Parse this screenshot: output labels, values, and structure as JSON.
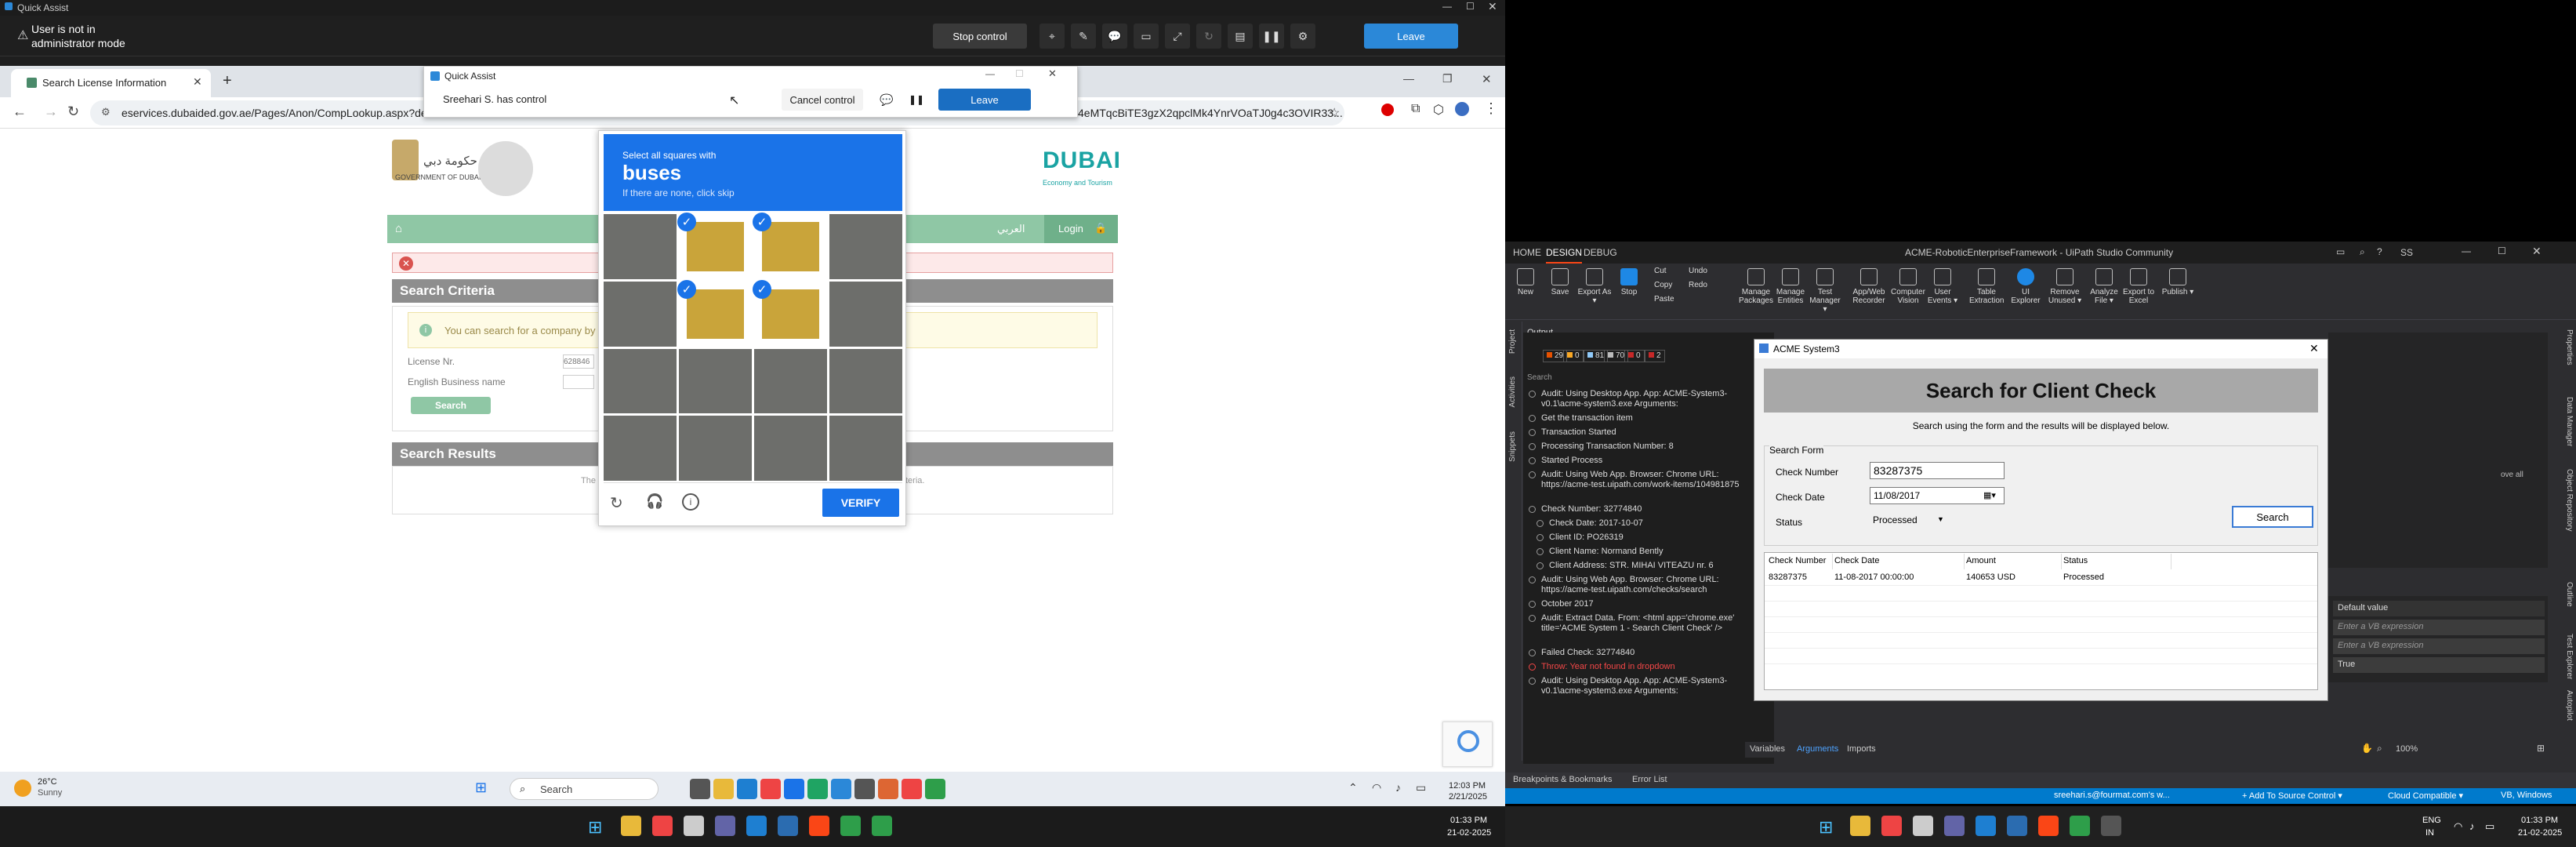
{
  "left": {
    "qa_window_title": "Quick Assist",
    "user_notice_line1": "User is not in",
    "user_notice_line2": "administrator mode",
    "stop_control": "Stop control",
    "leave": "Leave",
    "browser": {
      "tab_title": "Search License Information",
      "url": "eservices.dubaided.gov.ae/Pages/Anon/CompLookup.aspx?de",
      "url_tail": "4eMTqcBiTE3gzX2qpclMk4YnrVOaTJ0g4c3OVIR33...",
      "new_tab": "+"
    },
    "quick_assist_float": {
      "title": "Quick Assist",
      "status": "Sreehari S. has control",
      "cancel_control": "Cancel control",
      "leave": "Leave"
    },
    "dubai": {
      "gov_line1": "حكومة دبي",
      "gov_line2": "GOVERNMENT OF DUBAI",
      "ded_logo": "DUBAI",
      "ded_sub": "Economy and Tourism",
      "nav_arabic": "العربي",
      "nav_login": "Login",
      "search_criteria": "Search Criteria",
      "notice": "You can search for a company by lic",
      "license_label": "License Nr.",
      "license_placeholder": "628846",
      "business_label": "English Business name",
      "search_btn": "Search",
      "search_results": "Search Results",
      "results_text_left": "The",
      "results_text_right": "teria."
    },
    "captcha": {
      "instruction": "Select all squares with",
      "object": "buses",
      "hint": "If there are none, click skip",
      "verify": "VERIFY",
      "selected_cells": [
        1,
        2,
        5,
        6
      ]
    },
    "taskbar": {
      "temp": "26°C",
      "weather": "Sunny",
      "search": "Search",
      "time": "12:03 PM",
      "date": "2/21/2025"
    },
    "outer_time": "01:33 PM",
    "outer_date": "21-02-2025"
  },
  "studio": {
    "title": "ACME-RoboticEnterpriseFramework - UiPath Studio Community",
    "tabs": [
      "HOME",
      "DESIGN",
      "DEBUG"
    ],
    "user_initials": "SS",
    "ribbon": [
      {
        "label": "New"
      },
      {
        "label": "Save"
      },
      {
        "label": "Export As ▾"
      },
      {
        "label": "Stop"
      },
      {
        "label": "Cut"
      },
      {
        "label": "Copy"
      },
      {
        "label": "Paste"
      },
      {
        "label": "Undo"
      },
      {
        "label": "Redo"
      },
      {
        "label": "Manage Packages"
      },
      {
        "label": "Manage Entities"
      },
      {
        "label": "Test Manager ▾"
      },
      {
        "label": "App/Web Recorder"
      },
      {
        "label": "Computer Vision"
      },
      {
        "label": "User Events ▾"
      },
      {
        "label": "Table Extraction"
      },
      {
        "label": "UI Explorer"
      },
      {
        "label": "Remove Unused ▾"
      },
      {
        "label": "Analyze File ▾"
      },
      {
        "label": "Export to Excel"
      },
      {
        "label": "Publish ▾"
      }
    ],
    "output_title": "Output",
    "output_counts": [
      "29",
      "0",
      "81",
      "70",
      "0",
      "2"
    ],
    "output_search": "Search",
    "output_lines": [
      "Audit: Using Desktop App. App: ACME-System3-v0.1\\acme-system3.exe Arguments:",
      "Get the transaction item",
      "Transaction Started",
      "Processing Transaction Number: 8",
      "Started Process",
      "Audit: Using Web App. Browser: Chrome URL: https://acme-test.uipath.com/work-items/104981875",
      "Check Number: 32774840",
      "Check Date: 2017-10-07",
      "Client ID: PO26319",
      "Client Name: Normand Bently",
      "Client Address: STR. MIHAI VITEAZU nr. 6",
      "Audit: Using Web App. Browser: Chrome URL: https://acme-test.uipath.com/checks/search",
      "October 2017",
      "Audit: Extract Data. From: <html app='chrome.exe' title='ACME System 1 - Search Client Check' />",
      "Failed Check: 32774840",
      "Throw: Year not found in dropdown",
      "Audit: Using Desktop App. App: ACME-System3-v0.1\\acme-system3.exe Arguments:"
    ],
    "bottom_tabs": [
      "Breakpoints & Bookmarks",
      "Error List"
    ],
    "panel_tabs": [
      "Variables",
      "Arguments",
      "Imports"
    ],
    "zoom": "100%",
    "props": [
      {
        "label": "Default value"
      },
      {
        "label": "Enter a VB expression"
      },
      {
        "label": "Enter a VB expression"
      },
      {
        "label": "True"
      }
    ],
    "side_tabs_right": [
      "Properties",
      "Data Manager",
      "Object Repository",
      "Outline",
      "Test Explorer",
      "Autopilot"
    ],
    "side_tabs_left": [
      "Project",
      "Activities",
      "Snippets"
    ],
    "status_user": "sreehari.s@fourmat.com's w...",
    "status_source": "+ Add To Source Control ▾",
    "status_cloud": "Cloud Compatible ▾",
    "status_vb": "VB, Windows",
    "small_text": "ove all"
  },
  "acme": {
    "title": "ACME System3",
    "heading": "Search for Client Check",
    "subtitle": "Search using the form and the results will be displayed below.",
    "form_title": "Search Form",
    "check_number_label": "Check Number",
    "check_number": "83287375",
    "check_date_label": "Check Date",
    "check_date": "11/08/2017",
    "status_label": "Status",
    "status_value": "Processed",
    "search_btn": "Search",
    "columns": [
      "Check Number",
      "Check Date",
      "Amount",
      "Status"
    ],
    "rows": [
      [
        "83287375",
        "11-08-2017 00:00:00",
        "140653 USD",
        "Processed"
      ]
    ]
  },
  "right_taskbar": {
    "lang1": "ENG",
    "lang2": "IN",
    "time": "01:33 PM",
    "date": "21-02-2025"
  }
}
